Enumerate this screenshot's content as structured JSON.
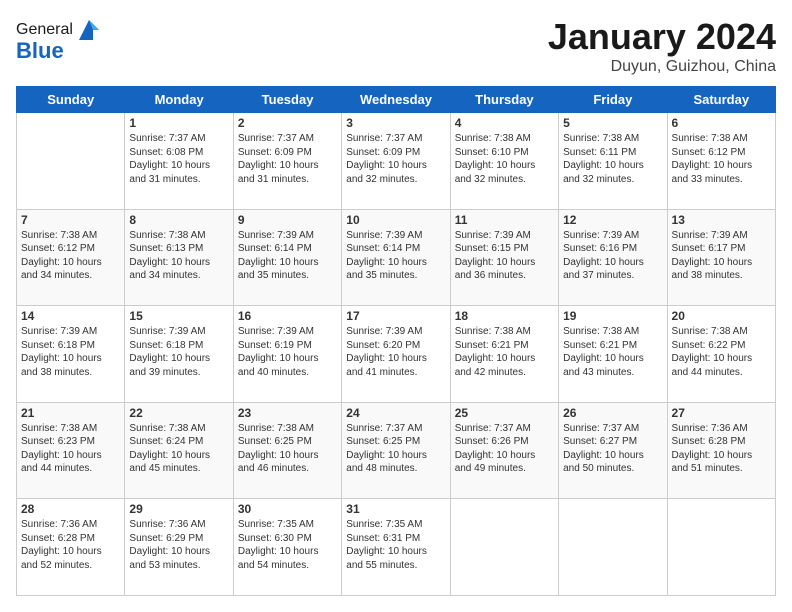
{
  "header": {
    "logo_line1": "General",
    "logo_line2": "Blue",
    "title": "January 2024",
    "subtitle": "Duyun, Guizhou, China"
  },
  "days_of_week": [
    "Sunday",
    "Monday",
    "Tuesday",
    "Wednesday",
    "Thursday",
    "Friday",
    "Saturday"
  ],
  "weeks": [
    [
      {
        "day": "",
        "info": ""
      },
      {
        "day": "1",
        "info": "Sunrise: 7:37 AM\nSunset: 6:08 PM\nDaylight: 10 hours\nand 31 minutes."
      },
      {
        "day": "2",
        "info": "Sunrise: 7:37 AM\nSunset: 6:09 PM\nDaylight: 10 hours\nand 31 minutes."
      },
      {
        "day": "3",
        "info": "Sunrise: 7:37 AM\nSunset: 6:09 PM\nDaylight: 10 hours\nand 32 minutes."
      },
      {
        "day": "4",
        "info": "Sunrise: 7:38 AM\nSunset: 6:10 PM\nDaylight: 10 hours\nand 32 minutes."
      },
      {
        "day": "5",
        "info": "Sunrise: 7:38 AM\nSunset: 6:11 PM\nDaylight: 10 hours\nand 32 minutes."
      },
      {
        "day": "6",
        "info": "Sunrise: 7:38 AM\nSunset: 6:12 PM\nDaylight: 10 hours\nand 33 minutes."
      }
    ],
    [
      {
        "day": "7",
        "info": "Sunrise: 7:38 AM\nSunset: 6:12 PM\nDaylight: 10 hours\nand 34 minutes."
      },
      {
        "day": "8",
        "info": "Sunrise: 7:38 AM\nSunset: 6:13 PM\nDaylight: 10 hours\nand 34 minutes."
      },
      {
        "day": "9",
        "info": "Sunrise: 7:39 AM\nSunset: 6:14 PM\nDaylight: 10 hours\nand 35 minutes."
      },
      {
        "day": "10",
        "info": "Sunrise: 7:39 AM\nSunset: 6:14 PM\nDaylight: 10 hours\nand 35 minutes."
      },
      {
        "day": "11",
        "info": "Sunrise: 7:39 AM\nSunset: 6:15 PM\nDaylight: 10 hours\nand 36 minutes."
      },
      {
        "day": "12",
        "info": "Sunrise: 7:39 AM\nSunset: 6:16 PM\nDaylight: 10 hours\nand 37 minutes."
      },
      {
        "day": "13",
        "info": "Sunrise: 7:39 AM\nSunset: 6:17 PM\nDaylight: 10 hours\nand 38 minutes."
      }
    ],
    [
      {
        "day": "14",
        "info": "Sunrise: 7:39 AM\nSunset: 6:18 PM\nDaylight: 10 hours\nand 38 minutes."
      },
      {
        "day": "15",
        "info": "Sunrise: 7:39 AM\nSunset: 6:18 PM\nDaylight: 10 hours\nand 39 minutes."
      },
      {
        "day": "16",
        "info": "Sunrise: 7:39 AM\nSunset: 6:19 PM\nDaylight: 10 hours\nand 40 minutes."
      },
      {
        "day": "17",
        "info": "Sunrise: 7:39 AM\nSunset: 6:20 PM\nDaylight: 10 hours\nand 41 minutes."
      },
      {
        "day": "18",
        "info": "Sunrise: 7:38 AM\nSunset: 6:21 PM\nDaylight: 10 hours\nand 42 minutes."
      },
      {
        "day": "19",
        "info": "Sunrise: 7:38 AM\nSunset: 6:21 PM\nDaylight: 10 hours\nand 43 minutes."
      },
      {
        "day": "20",
        "info": "Sunrise: 7:38 AM\nSunset: 6:22 PM\nDaylight: 10 hours\nand 44 minutes."
      }
    ],
    [
      {
        "day": "21",
        "info": "Sunrise: 7:38 AM\nSunset: 6:23 PM\nDaylight: 10 hours\nand 44 minutes."
      },
      {
        "day": "22",
        "info": "Sunrise: 7:38 AM\nSunset: 6:24 PM\nDaylight: 10 hours\nand 45 minutes."
      },
      {
        "day": "23",
        "info": "Sunrise: 7:38 AM\nSunset: 6:25 PM\nDaylight: 10 hours\nand 46 minutes."
      },
      {
        "day": "24",
        "info": "Sunrise: 7:37 AM\nSunset: 6:25 PM\nDaylight: 10 hours\nand 48 minutes."
      },
      {
        "day": "25",
        "info": "Sunrise: 7:37 AM\nSunset: 6:26 PM\nDaylight: 10 hours\nand 49 minutes."
      },
      {
        "day": "26",
        "info": "Sunrise: 7:37 AM\nSunset: 6:27 PM\nDaylight: 10 hours\nand 50 minutes."
      },
      {
        "day": "27",
        "info": "Sunrise: 7:36 AM\nSunset: 6:28 PM\nDaylight: 10 hours\nand 51 minutes."
      }
    ],
    [
      {
        "day": "28",
        "info": "Sunrise: 7:36 AM\nSunset: 6:28 PM\nDaylight: 10 hours\nand 52 minutes."
      },
      {
        "day": "29",
        "info": "Sunrise: 7:36 AM\nSunset: 6:29 PM\nDaylight: 10 hours\nand 53 minutes."
      },
      {
        "day": "30",
        "info": "Sunrise: 7:35 AM\nSunset: 6:30 PM\nDaylight: 10 hours\nand 54 minutes."
      },
      {
        "day": "31",
        "info": "Sunrise: 7:35 AM\nSunset: 6:31 PM\nDaylight: 10 hours\nand 55 minutes."
      },
      {
        "day": "",
        "info": ""
      },
      {
        "day": "",
        "info": ""
      },
      {
        "day": "",
        "info": ""
      }
    ]
  ]
}
